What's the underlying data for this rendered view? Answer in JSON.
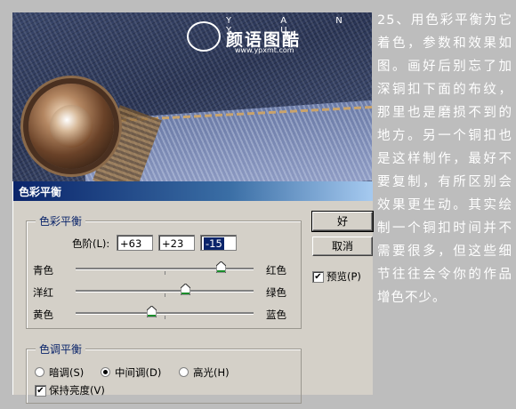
{
  "watermark": {
    "letters": "Y A N Y U",
    "name": "颜语图酷",
    "url": "www.ypxmt.com"
  },
  "dialog": {
    "title": "色彩平衡",
    "color_balance_group": "色彩平衡",
    "levels_label": "色阶(L):",
    "levels_values": [
      "+63",
      "+23",
      "-15"
    ],
    "sliders": [
      {
        "left": "青色",
        "right": "红色",
        "value": 63
      },
      {
        "left": "洋红",
        "right": "绿色",
        "value": 23
      },
      {
        "left": "黄色",
        "right": "蓝色",
        "value": -15
      }
    ],
    "ok_label": "好",
    "cancel_label": "取消",
    "preview_label": "预览(P)",
    "preview_checked": true,
    "tone_group": "色调平衡",
    "tones": [
      {
        "label": "暗调(S)",
        "selected": false
      },
      {
        "label": "中间调(D)",
        "selected": true
      },
      {
        "label": "高光(H)",
        "selected": false
      }
    ],
    "preserve_label": "保持亮度(V)",
    "preserve_checked": true
  },
  "article_text": "25、用色彩平衡为它着色，参数和效果如图。画好后别忘了加深铜扣下面的布纹，那里也是磨损不到的地方。另一个铜扣也是这样制作，最好不要复制，有所区别会效果更生动。其实绘制一个铜扣时间并不需要很多，但这些细节往往会令你的作品增色不少。"
}
